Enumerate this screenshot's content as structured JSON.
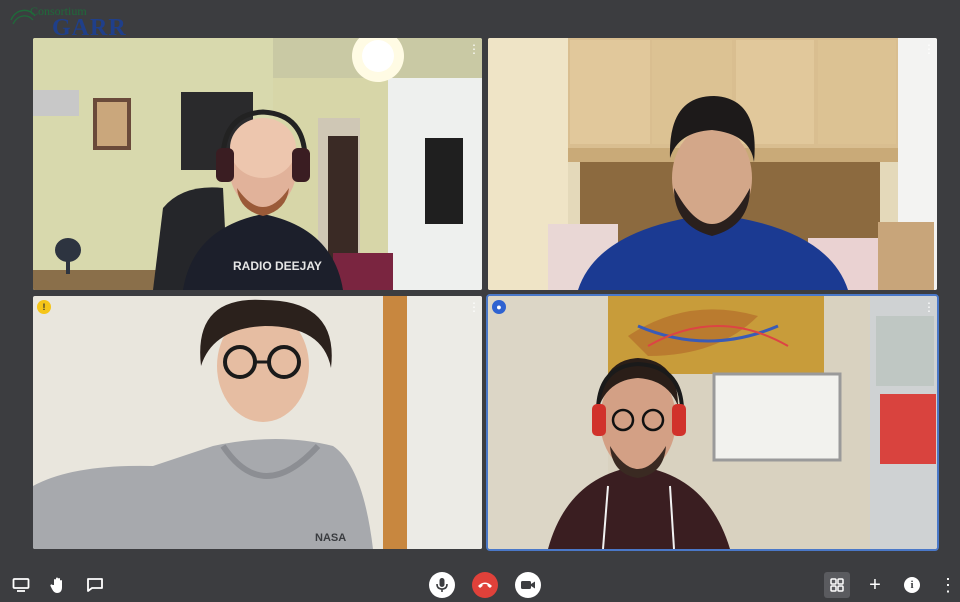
{
  "logo": {
    "sub": "Consortium",
    "main": "GARR"
  },
  "tiles": [
    {
      "id": "participant-1",
      "badge": "",
      "menu": "⋮"
    },
    {
      "id": "participant-2",
      "badge": "",
      "menu": "⋮"
    },
    {
      "id": "participant-3",
      "badge": "!",
      "menu": "⋮"
    },
    {
      "id": "participant-4",
      "badge": "●",
      "menu": "⋮"
    }
  ],
  "shirt_text": "RADIO DEEJAY",
  "hoodie_text": "NASA",
  "toolbar": {
    "left": [
      "screen-share-icon",
      "raise-hand-icon",
      "chat-icon"
    ],
    "center": [
      "microphone-icon",
      "hangup-icon",
      "camera-icon"
    ],
    "right": [
      "tile-view-icon",
      "invite-icon",
      "info-icon",
      "more-icon"
    ],
    "plus": "+",
    "more": "⋮",
    "info": "i"
  },
  "colors": {
    "accent_blue": "#2f63d1",
    "hangup_red": "#e0413a",
    "badge_yellow": "#f5c518",
    "background": "#3c3d40"
  }
}
